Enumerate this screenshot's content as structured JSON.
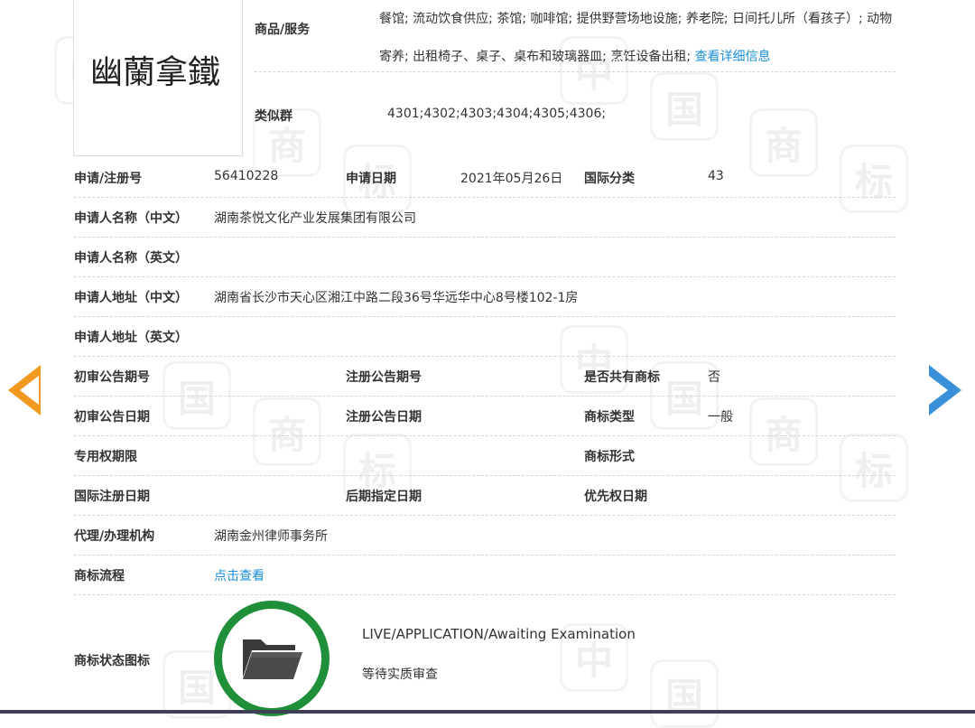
{
  "logo": {
    "text": "幽蘭拿鐵"
  },
  "goods": {
    "label": "商品/服务",
    "text": "餐馆; 流动饮食供应; 茶馆; 咖啡馆; 提供野营场地设施; 养老院; 日间托儿所（看孩子）; 动物寄养; 出租椅子、桌子、桌布和玻璃器皿; 烹饪设备出租; ",
    "link": "查看详细信息"
  },
  "similar": {
    "label": "类似群",
    "value": "4301;4302;4303;4304;4305;4306;"
  },
  "rows": {
    "reg_no": {
      "label": "申请/注册号",
      "value": "56410228"
    },
    "app_date": {
      "label": "申请日期",
      "value": "2021年05月26日"
    },
    "intl_class": {
      "label": "国际分类",
      "value": "43"
    },
    "applicant_cn": {
      "label": "申请人名称（中文）",
      "value": "湖南茶悦文化产业发展集团有限公司"
    },
    "applicant_en": {
      "label": "申请人名称（英文）",
      "value": ""
    },
    "address_cn": {
      "label": "申请人地址（中文）",
      "value": "湖南省长沙市天心区湘江中路二段36号华远华中心8号楼102-1房"
    },
    "address_en": {
      "label": "申请人地址（英文）",
      "value": ""
    },
    "prelim_pub_no": {
      "label": "初审公告期号",
      "value": ""
    },
    "reg_pub_no": {
      "label": "注册公告期号",
      "value": ""
    },
    "shared": {
      "label": "是否共有商标",
      "value": "否"
    },
    "prelim_pub_date": {
      "label": "初审公告日期",
      "value": ""
    },
    "reg_pub_date": {
      "label": "注册公告日期",
      "value": ""
    },
    "tm_type": {
      "label": "商标类型",
      "value": "一般"
    },
    "exclusive_term": {
      "label": "专用权期限",
      "value": ""
    },
    "tm_form": {
      "label": "商标形式",
      "value": ""
    },
    "intl_reg_date": {
      "label": "国际注册日期",
      "value": ""
    },
    "later_date": {
      "label": "后期指定日期",
      "value": ""
    },
    "priority_date": {
      "label": "优先权日期",
      "value": ""
    },
    "agent": {
      "label": "代理/办理机构",
      "value": "湖南金州律师事务所"
    },
    "flow": {
      "label": "商标流程",
      "link": "点击查看"
    }
  },
  "status": {
    "label": "商标状态图标",
    "en": "LIVE/APPLICATION/Awaiting Examination",
    "cn": "等待实质审查",
    "icon": "folder-icon",
    "ring_color": "#1f8f3a"
  },
  "nav": {
    "prev_icon": "arrow-left-icon",
    "next_icon": "arrow-right-icon",
    "prev_color": "#f29a1f",
    "next_color": "#3a8fd9"
  },
  "watermark": [
    "中",
    "国",
    "商",
    "标"
  ]
}
